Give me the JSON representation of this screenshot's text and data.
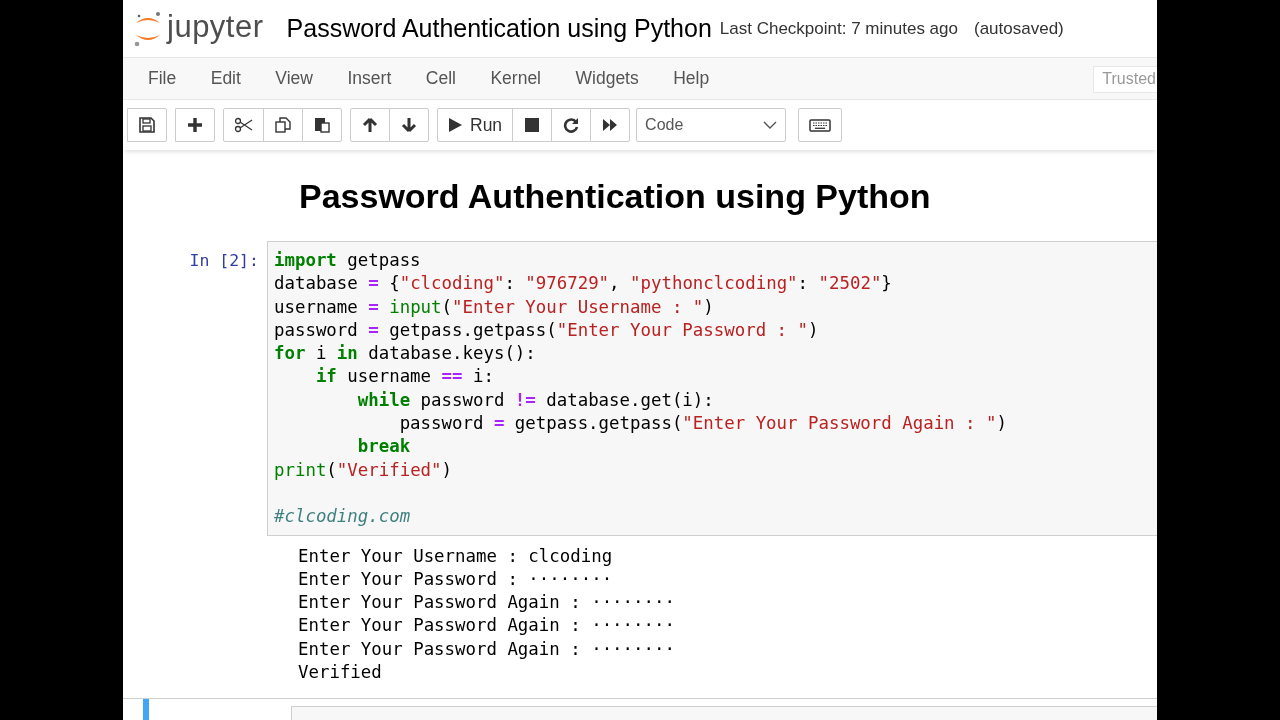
{
  "header": {
    "logo_text": "jupyter",
    "notebook_title": "Password Authentication using Python",
    "checkpoint": "Last Checkpoint: 7 minutes ago",
    "autosave": "(autosaved)"
  },
  "menu": [
    "File",
    "Edit",
    "View",
    "Insert",
    "Cell",
    "Kernel",
    "Widgets",
    "Help"
  ],
  "trusted": "Trusted",
  "toolbar": {
    "groups": [
      [
        {
          "kind": "save"
        }
      ],
      [
        {
          "kind": "add"
        }
      ],
      [
        {
          "kind": "cut"
        },
        {
          "kind": "copy"
        },
        {
          "kind": "paste"
        }
      ],
      [
        {
          "kind": "up"
        },
        {
          "kind": "down"
        }
      ],
      [
        {
          "kind": "run",
          "label": "Run"
        },
        {
          "kind": "stop"
        },
        {
          "kind": "restart"
        },
        {
          "kind": "fast-forward"
        }
      ]
    ],
    "cell_type": "Code"
  },
  "cells": [
    {
      "kind": "markdown",
      "heading": "Password Authentication using Python"
    },
    {
      "kind": "code",
      "prompt": "In [2]:",
      "lines": [
        {
          "tokens": [
            {
              "text": "import",
              "kind": "kw"
            },
            {
              "text": " getpass",
              "kind": "plain"
            }
          ]
        },
        {
          "tokens": [
            {
              "text": "database ",
              "kind": "plain"
            },
            {
              "text": "=",
              "kind": "op"
            },
            {
              "text": " {",
              "kind": "plain"
            },
            {
              "text": "\"clcoding\"",
              "kind": "str"
            },
            {
              "text": ": ",
              "kind": "plain"
            },
            {
              "text": "\"976729\"",
              "kind": "str"
            },
            {
              "text": ", ",
              "kind": "plain"
            },
            {
              "text": "\"pythonclcoding\"",
              "kind": "str"
            },
            {
              "text": ": ",
              "kind": "plain"
            },
            {
              "text": "\"2502\"",
              "kind": "str"
            },
            {
              "text": "}",
              "kind": "plain"
            }
          ]
        },
        {
          "tokens": [
            {
              "text": "username ",
              "kind": "plain"
            },
            {
              "text": "= ",
              "kind": "op"
            },
            {
              "text": "input",
              "kind": "builtin"
            },
            {
              "text": "(",
              "kind": "plain"
            },
            {
              "text": "\"Enter Your Username : \"",
              "kind": "str"
            },
            {
              "text": ")",
              "kind": "plain"
            }
          ]
        },
        {
          "tokens": [
            {
              "text": "password ",
              "kind": "plain"
            },
            {
              "text": "=",
              "kind": "op"
            },
            {
              "text": " getpass.getpass(",
              "kind": "plain"
            },
            {
              "text": "\"Enter Your Password : \"",
              "kind": "str"
            },
            {
              "text": ")",
              "kind": "plain"
            }
          ]
        },
        {
          "tokens": [
            {
              "text": "for",
              "kind": "kw"
            },
            {
              "text": " i ",
              "kind": "plain"
            },
            {
              "text": "in",
              "kind": "kw"
            },
            {
              "text": " database.keys():",
              "kind": "plain"
            }
          ]
        },
        {
          "tokens": [
            {
              "text": "    if",
              "kind": "kw"
            },
            {
              "text": " username ",
              "kind": "plain"
            },
            {
              "text": "==",
              "kind": "op"
            },
            {
              "text": " i:",
              "kind": "plain"
            }
          ]
        },
        {
          "tokens": [
            {
              "text": "        while",
              "kind": "kw"
            },
            {
              "text": " password ",
              "kind": "plain"
            },
            {
              "text": "!=",
              "kind": "op"
            },
            {
              "text": " database.get(i):",
              "kind": "plain"
            }
          ]
        },
        {
          "tokens": [
            {
              "text": "            password ",
              "kind": "plain"
            },
            {
              "text": "=",
              "kind": "op"
            },
            {
              "text": " getpass.getpass(",
              "kind": "plain"
            },
            {
              "text": "\"Enter Your Password Again : \"",
              "kind": "str"
            },
            {
              "text": ")",
              "kind": "plain"
            }
          ]
        },
        {
          "tokens": [
            {
              "text": "        break",
              "kind": "kw"
            }
          ]
        },
        {
          "tokens": [
            {
              "text": "print",
              "kind": "builtin"
            },
            {
              "text": "(",
              "kind": "plain"
            },
            {
              "text": "\"Verified\"",
              "kind": "str"
            },
            {
              "text": ")",
              "kind": "plain"
            }
          ]
        },
        {
          "kind": "blank"
        },
        {
          "tokens": [
            {
              "text": "#clcoding.com",
              "kind": "comment"
            }
          ]
        }
      ],
      "output": [
        "Enter Your Username : clcoding",
        "Enter Your Password : ········",
        "Enter Your Password Again : ········",
        "Enter Your Password Again : ········",
        "Enter Your Password Again : ········",
        "Verified"
      ]
    },
    {
      "kind": "empty",
      "selected": true
    }
  ]
}
